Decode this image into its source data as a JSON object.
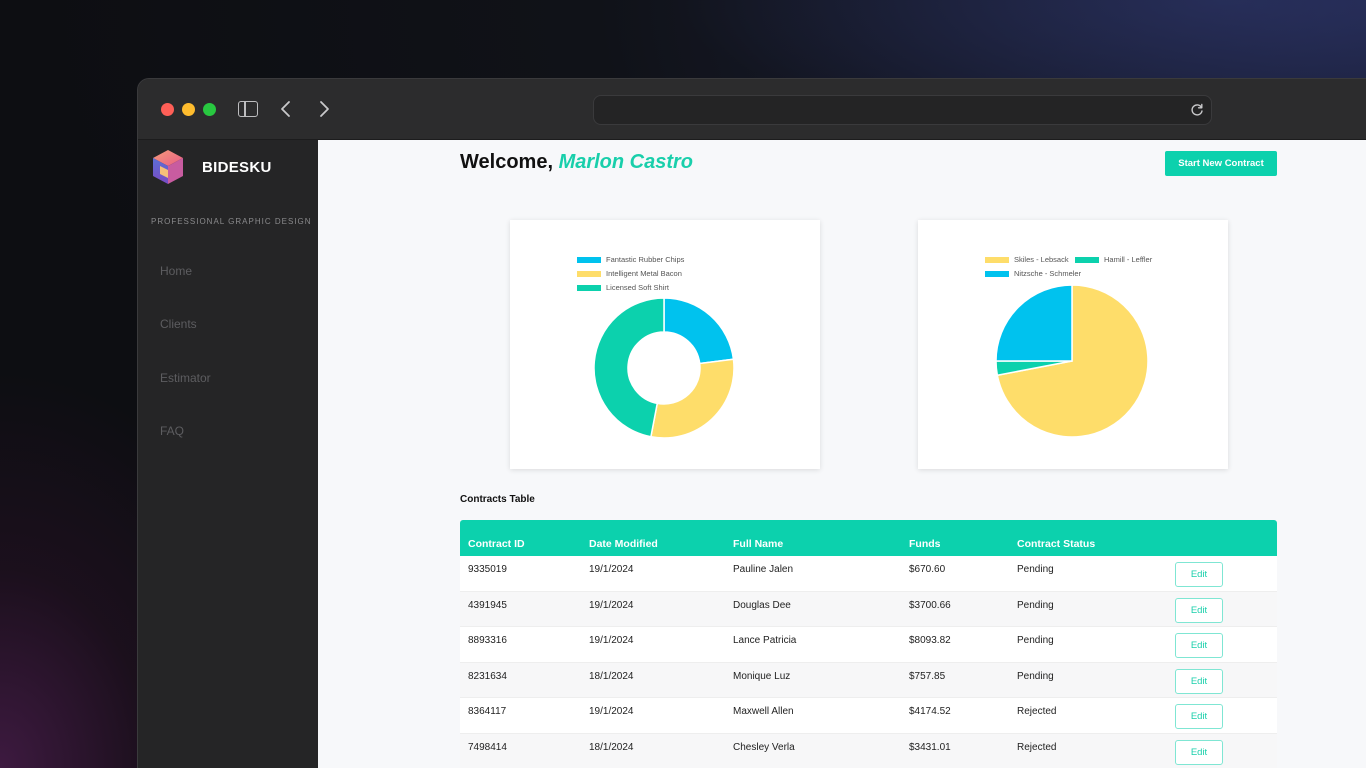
{
  "browser": {
    "url": ""
  },
  "brand": {
    "name": "BIDESKU",
    "tagline": "PROFESSIONAL GRAPHIC DESIGN"
  },
  "sidebar": {
    "items": [
      {
        "label": "Home"
      },
      {
        "label": "Clients"
      },
      {
        "label": "Estimator"
      },
      {
        "label": "FAQ"
      }
    ]
  },
  "header": {
    "welcome_prefix": "Welcome,",
    "user_name": "Marlon Castro",
    "new_contract_button": "Start New Contract"
  },
  "colors": {
    "accent": "#0cd1ad",
    "chart_blue": "#00c2ee",
    "chart_yellow": "#fedd6a",
    "chart_teal": "#0cd1ad"
  },
  "chart_data": [
    {
      "type": "pie",
      "variant": "doughnut",
      "legend_position": "top",
      "labels": [
        "Fantastic Rubber Chips",
        "Intelligent Metal Bacon",
        "Licensed Soft Shirt"
      ],
      "values": [
        23,
        30,
        47
      ],
      "colors": [
        "#00c2ee",
        "#fedd6a",
        "#0cd1ad"
      ]
    },
    {
      "type": "pie",
      "variant": "pie",
      "legend_position": "top",
      "labels": [
        "Skiles - Lebsack",
        "Hamill - Leffler",
        "Nitzsche - Schmeler"
      ],
      "values": [
        72,
        3,
        25
      ],
      "colors": [
        "#fedd6a",
        "#0cd1ad",
        "#00c2ee"
      ]
    }
  ],
  "table": {
    "title": "Contracts Table",
    "columns": [
      "Contract ID",
      "Date Modified",
      "Full Name",
      "Funds",
      "Contract Status"
    ],
    "edit_label": "Edit",
    "rows": [
      {
        "id": "9335019",
        "date": "19/1/2024",
        "name": "Pauline Jalen",
        "funds": "$670.60",
        "status": "Pending"
      },
      {
        "id": "4391945",
        "date": "19/1/2024",
        "name": "Douglas Dee",
        "funds": "$3700.66",
        "status": "Pending"
      },
      {
        "id": "8893316",
        "date": "19/1/2024",
        "name": "Lance Patricia",
        "funds": "$8093.82",
        "status": "Pending"
      },
      {
        "id": "8231634",
        "date": "18/1/2024",
        "name": "Monique Luz",
        "funds": "$757.85",
        "status": "Pending"
      },
      {
        "id": "8364117",
        "date": "19/1/2024",
        "name": "Maxwell Allen",
        "funds": "$4174.52",
        "status": "Rejected"
      },
      {
        "id": "7498414",
        "date": "18/1/2024",
        "name": "Chesley Verla",
        "funds": "$3431.01",
        "status": "Rejected"
      }
    ]
  }
}
